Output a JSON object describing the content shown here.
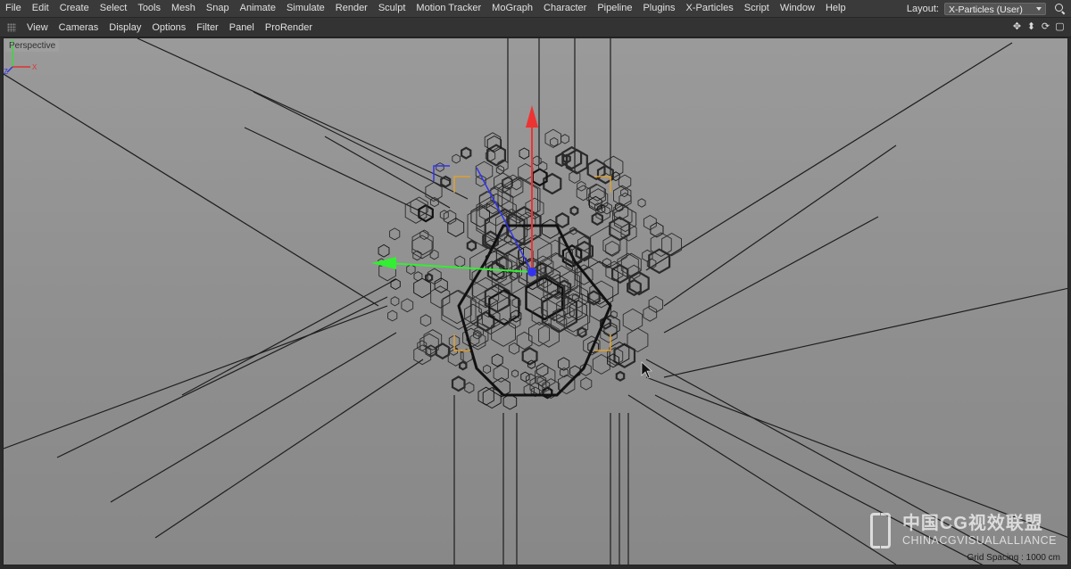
{
  "menu": {
    "items": [
      "File",
      "Edit",
      "Create",
      "Select",
      "Tools",
      "Mesh",
      "Snap",
      "Animate",
      "Simulate",
      "Render",
      "Sculpt",
      "Motion Tracker",
      "MoGraph",
      "Character",
      "Pipeline",
      "Plugins",
      "X-Particles",
      "Script",
      "Window",
      "Help"
    ],
    "layout_label": "Layout:",
    "layout_value": "X-Particles (User)"
  },
  "viewbar": {
    "items": [
      "View",
      "Cameras",
      "Display",
      "Options",
      "Filter",
      "Panel",
      "ProRender"
    ],
    "nav_icons": [
      "move-view-icon",
      "dolly-view-icon",
      "rotate-view-icon",
      "maximize-view-icon"
    ]
  },
  "viewport": {
    "camera_label": "Perspective",
    "grid_spacing": "Grid Spacing : 1000 cm",
    "axis": {
      "y": "Y",
      "z": "Z",
      "x": "X"
    },
    "colors": {
      "x_axis": "#33ee33",
      "y_axis": "#ee3333",
      "z_axis": "#3333ee",
      "selection": "#e0a030"
    }
  },
  "watermark": {
    "cn": "中国CG视效联盟",
    "en": "CHINACGVISUALALLIANCE"
  }
}
